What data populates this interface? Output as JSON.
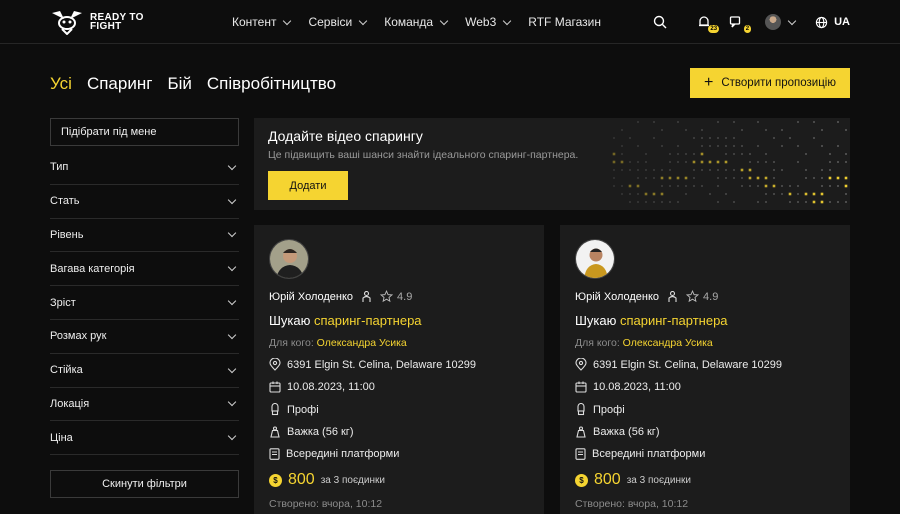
{
  "header": {
    "logo_text": "READY TO FIGHT",
    "nav": [
      {
        "label": "Контент",
        "has_dropdown": true
      },
      {
        "label": "Сервіси",
        "has_dropdown": true
      },
      {
        "label": "Команда",
        "has_dropdown": true
      },
      {
        "label": "Web3",
        "has_dropdown": true
      },
      {
        "label": "RTF Магазин",
        "has_dropdown": false
      }
    ],
    "notifications_badge": "23",
    "messages_badge": "2",
    "language": "UA"
  },
  "tabs": [
    {
      "label": "Усі",
      "active": true
    },
    {
      "label": "Спаринг",
      "active": false
    },
    {
      "label": "Бій",
      "active": false
    },
    {
      "label": "Співробітництво",
      "active": false
    }
  ],
  "create_button": "Створити пропозицію",
  "sidebar": {
    "match_button": "Підібрати під мене",
    "filters": [
      "Тип",
      "Стать",
      "Рівень",
      "Вагава категорія",
      "Зріст",
      "Розмах рук",
      "Стійка",
      "Локація",
      "Ціна"
    ],
    "reset_button": "Скинути фільтри"
  },
  "banner": {
    "title": "Додайте відео спарингу",
    "subtitle": "Це підвищить ваші шанси знайти ідеального спаринг-партнера.",
    "button": "Додати"
  },
  "cards": [
    {
      "name": "Юрій Холоденко",
      "rating": "4.9",
      "title_prefix": "Шукаю ",
      "title_highlight": "спаринг-партнера",
      "for_label": "Для кого: ",
      "for_value": "Олександра Усика",
      "address": "6391 Elgin St. Celina, Delaware 10299",
      "datetime": "10.08.2023, 11:00",
      "level": "Профі",
      "weight": "Важка (56 кг)",
      "platform": "Всередині платформи",
      "price": "800",
      "price_unit": "за 3 поєдинки",
      "created": "Створено: вчора, 10:12"
    },
    {
      "name": "Юрій Холоденко",
      "rating": "4.9",
      "title_prefix": "Шукаю ",
      "title_highlight": "спаринг-партнера",
      "for_label": "Для кого: ",
      "for_value": "Олександра Усика",
      "address": "6391 Elgin St. Celina, Delaware 10299",
      "datetime": "10.08.2023, 11:00",
      "level": "Профі",
      "weight": "Важка (56 кг)",
      "platform": "Всередині платформи",
      "price": "800",
      "price_unit": "за 3 поєдинки",
      "created": "Створено: вчора, 10:12"
    }
  ],
  "colors": {
    "accent": "#f5d431",
    "background": "#0d0d0d",
    "card": "#1c1c1c"
  }
}
